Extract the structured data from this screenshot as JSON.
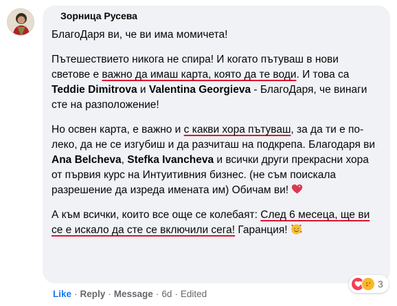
{
  "comment": {
    "author": "Зорница Русева",
    "paragraphs": {
      "p1": "БлагоДаря ви, че ви има момичета!",
      "p2_a": "Пътешествието никога не спира! И когато пътуваш в нови светове е ",
      "p2_ul1": "важно да имаш карта, която да те води",
      "p2_b": ". И това са ",
      "p2_name1": "Teddie Dimitrova",
      "p2_c": " и ",
      "p2_name2": "Valentina Georgieva",
      "p2_d": " - БлагоДаря, че винаги сте на разположение!",
      "p3_a": "Но освен карта, е важно и ",
      "p3_ul": "с какви хора пътуваш",
      "p3_b": ", за да ти е по-леко, да не се изгубиш и да разчиташ на подкрепа. Благодаря ви ",
      "p3_name1": "Ana Belcheva",
      "p3_c": ", ",
      "p3_name2": "Stefka Ivancheva",
      "p3_d": " и всички други прекрасни хора от първия курс на Интуитивния бизнес. (не съм поискала разрешение да изреда имената им) Обичам ви! ",
      "p4_a": "А към всички, които все още се колебаят: ",
      "p4_ul": "След 6 месеца, ще ви се е искало да сте се включили сега!",
      "p4_b": " Гаранция! "
    },
    "emojis": {
      "heart": "heart-emoji",
      "smiling_hearts": "smiling-face-with-hearts-emoji"
    }
  },
  "actions": {
    "like": "Like",
    "reply": "Reply",
    "message": "Message",
    "time": "6d",
    "edited": "Edited",
    "separator": "·"
  },
  "reactions": {
    "count": "3",
    "types": [
      "love-reaction-icon",
      "care-reaction-icon"
    ]
  },
  "colors": {
    "bubble": "#f0f2f5",
    "like": "#1877f2",
    "underline": "#e0112f",
    "meta": "#65676b"
  }
}
